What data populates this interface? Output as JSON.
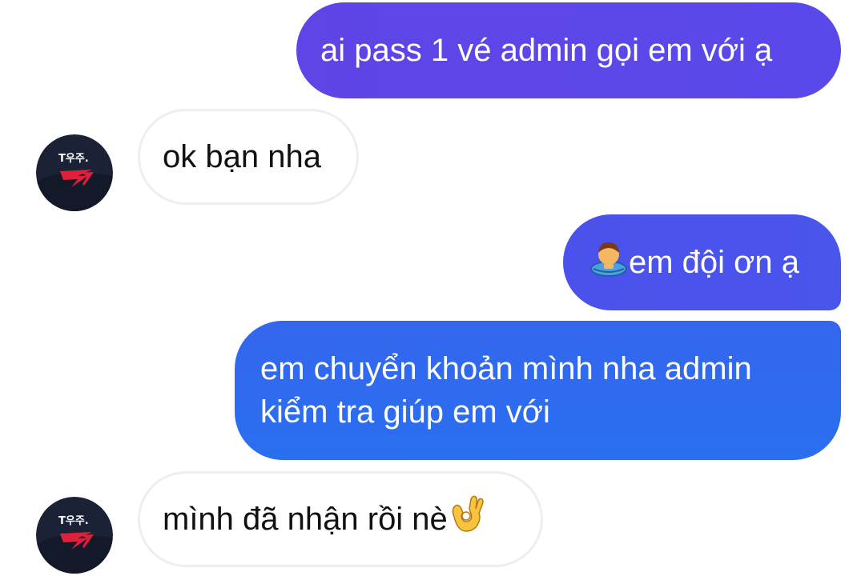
{
  "conversation": {
    "messages": [
      {
        "direction": "outgoing",
        "text": "ai pass 1 vé admin gọi em với ạ"
      },
      {
        "direction": "incoming",
        "text": "ok bạn nha",
        "avatar_icon": "t1-logo-icon"
      },
      {
        "direction": "outgoing",
        "emoji": "person-bowing-icon",
        "text": "em đội ơn ạ"
      },
      {
        "direction": "outgoing",
        "lines": [
          "em chuyển khoản mình nha admin",
          "kiểm tra giúp em với"
        ]
      },
      {
        "direction": "incoming",
        "text": "mình đã nhận rồi nè",
        "emoji": "ok-hand-icon",
        "avatar_icon": "t1-logo-icon"
      }
    ]
  },
  "avatar": {
    "logo_text": "T우주."
  },
  "colors": {
    "outgoing_top": "#5b46e8",
    "outgoing_mid": "#4955ec",
    "outgoing_bottom": "#2a6ef0",
    "incoming_bg": "#ffffff",
    "incoming_border": "#eeeeee",
    "avatar_bg": "#1b2236",
    "logo_red": "#e0203a"
  }
}
